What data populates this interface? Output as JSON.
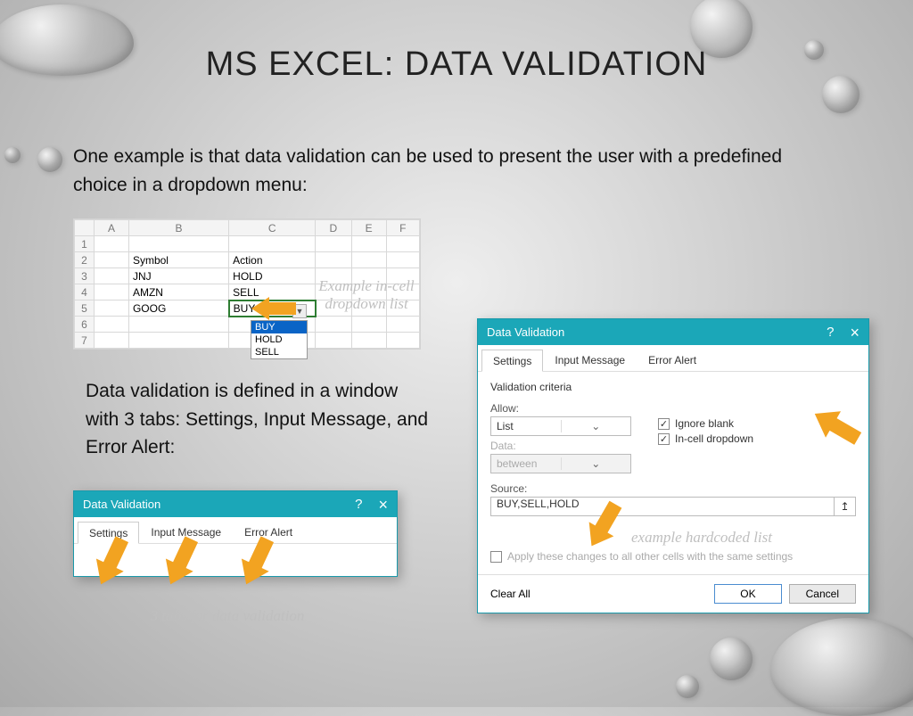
{
  "title": "MS EXCEL:  DATA VALIDATION",
  "intro": "One example is that data validation can be used to present the user with a predefined choice in a dropdown menu:",
  "midtext": "Data validation is defined in a window with 3 tabs: Settings, Input Message, and Error Alert:",
  "sheet": {
    "cols": [
      "A",
      "B",
      "C",
      "D",
      "E",
      "F"
    ],
    "header_symbol": "Symbol",
    "header_action": "Action",
    "rows": [
      {
        "b": "JNJ",
        "c": "HOLD"
      },
      {
        "b": "AMZN",
        "c": "SELL"
      },
      {
        "b": "GOOG",
        "c": "BUY"
      }
    ],
    "dropdown": [
      "BUY",
      "HOLD",
      "SELL"
    ]
  },
  "caption1": "Example in-cell dropdown list",
  "caption2": "3 tabs for data validation",
  "caption3": "example hardcoded list",
  "dialog": {
    "title": "Data Validation",
    "tabs": [
      "Settings",
      "Input Message",
      "Error Alert"
    ],
    "criteria_label": "Validation criteria",
    "allow_label": "Allow:",
    "allow_value": "List",
    "data_label": "Data:",
    "data_value": "between",
    "ignore_blank": "Ignore blank",
    "incell_dropdown": "In-cell dropdown",
    "source_label": "Source:",
    "source_value": "BUY,SELL,HOLD",
    "apply_all": "Apply these changes to all other cells with the same settings",
    "clear": "Clear All",
    "ok": "OK",
    "cancel": "Cancel"
  }
}
